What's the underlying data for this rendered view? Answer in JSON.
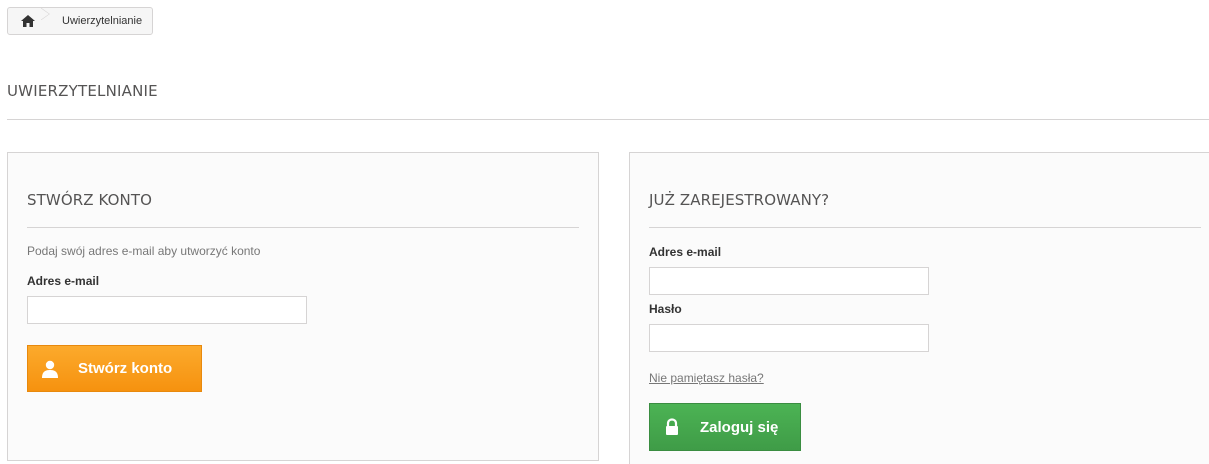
{
  "breadcrumb": {
    "home_icon": "home-icon",
    "current": "Uwierzytelnianie"
  },
  "page": {
    "heading": "UWIERZYTELNIANIE"
  },
  "create_account": {
    "title": "STWÓRZ KONTO",
    "description": "Podaj swój adres e-mail aby utworzyć konto",
    "email_label": "Adres e-mail",
    "email_value": "",
    "button_label": "Stwórz konto",
    "button_icon": "user-icon",
    "button_color": "#f99d1c"
  },
  "login": {
    "title": "JUŻ ZAREJESTROWANY?",
    "email_label": "Adres e-mail",
    "email_value": "",
    "password_label": "Hasło",
    "password_value": "",
    "forgot_link": "Nie pamiętasz hasła?",
    "button_label": "Zaloguj się",
    "button_icon": "lock-icon",
    "button_color": "#46a74e"
  }
}
